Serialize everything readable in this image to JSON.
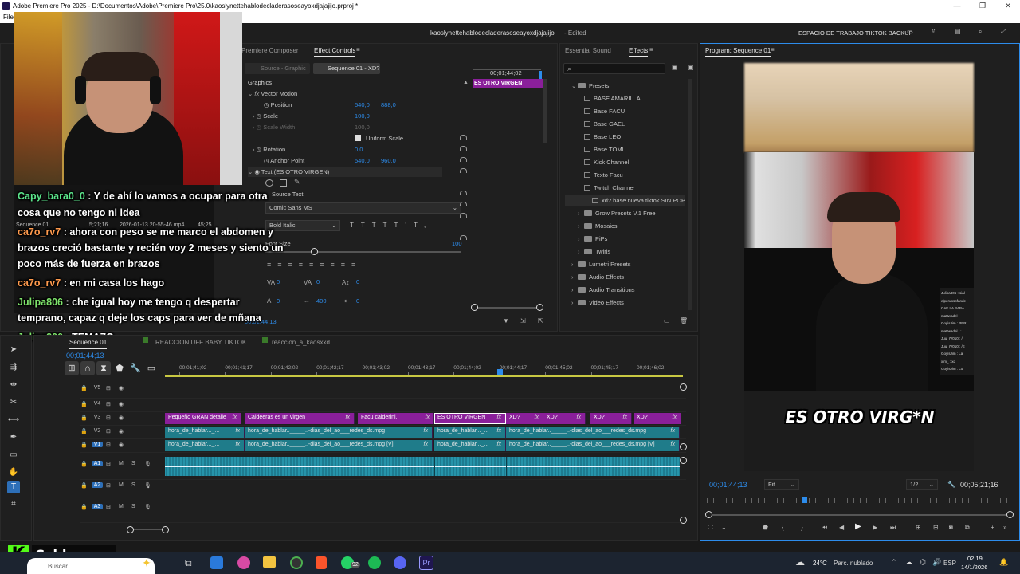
{
  "window": {
    "title": "Adobe Premiere Pro 2025 - D:\\Documentos\\Adobe\\Premiere Pro\\25.0\\kaoslynettehablodecladerasoseayoxdjajajijo.prproj *",
    "project_name": "kaoslynettehablodecladerasoseayoxdjajajijo",
    "edited": "- Edited",
    "workspace": "ESPACIO DE TRABAJO TIKTOK BACKUP",
    "menu_file": "File"
  },
  "source_panel": {
    "tabs": [
      "Premiere Composer",
      "Effect Controls"
    ],
    "subtabs": [
      "Source - Graphic",
      "Sequence 01 - XD?"
    ],
    "timecode": "00;01;44;02",
    "clip_label": "ES OTRO VIRGEN",
    "graphics_label": "Graphics",
    "vector_motion": "Vector Motion",
    "properties": [
      {
        "name": "Position",
        "v1": "540,0",
        "v2": "888,0"
      },
      {
        "name": "Scale",
        "v1": "100,0",
        "v2": ""
      },
      {
        "name": "Scale Width",
        "v1": "100,0",
        "v2": ""
      },
      {
        "name": "Rotation",
        "v1": "0,0",
        "v2": ""
      },
      {
        "name": "Anchor Point",
        "v1": "540,0",
        "v2": "960,0"
      }
    ],
    "uniform_scale": "Uniform Scale",
    "text_layer": "Text (ES OTRO VIRGEN)",
    "source_text": "Source Text",
    "font": "Comic Sans MS",
    "font_style": "Bold Italic",
    "font_size_label": "Font Size",
    "font_size": "100",
    "tracking_values": [
      "0",
      "0",
      "0",
      "0",
      "400",
      "0"
    ],
    "bottom_timecode": "00;01;44;13"
  },
  "webcam": {
    "seq_label": "Sequence 01",
    "seq_time": "5;21;16",
    "file_label": "2026-01-13 20-55-46.mp4",
    "file_time": "45;25"
  },
  "chat": [
    {
      "user": "Capy_bara0_0",
      "text": ": Y de ahí lo vamos a ocupar para otra",
      "text2": "cosa que no tengo ni idea"
    },
    {
      "user": "ca7o_rv7",
      "text": ": ahora con peso se me marco el abdomen y",
      "text2": "brazos creció bastante y recién voy 2 meses y siento un",
      "text3": "poco más de fuerza en brazos"
    },
    {
      "user": "ca7o_rv7",
      "text": ": en mi casa los hago"
    },
    {
      "user": "Julipa806",
      "text": ": che igual hoy me tengo q despertar",
      "text2": "temprano, capaz q deje los caps para ver de mñana"
    },
    {
      "user": "Julipa806",
      "text": ": TEMAZO"
    }
  ],
  "effects_panel": {
    "tabs": [
      "Essential Sound",
      "Effects"
    ],
    "search_placeholder": "",
    "tree": [
      {
        "level": 0,
        "type": "folder",
        "open": true,
        "label": "Presets"
      },
      {
        "level": 1,
        "type": "preset",
        "label": "BASE AMARILLA"
      },
      {
        "level": 1,
        "type": "preset",
        "label": "Base FACU"
      },
      {
        "level": 1,
        "type": "preset",
        "label": "Base GAEL"
      },
      {
        "level": 1,
        "type": "preset",
        "label": "Base LEO"
      },
      {
        "level": 1,
        "type": "preset",
        "label": "Base TOMI"
      },
      {
        "level": 1,
        "type": "preset",
        "label": "Kick Channel"
      },
      {
        "level": 1,
        "type": "preset",
        "label": "Texto Facu"
      },
      {
        "level": 1,
        "type": "preset",
        "label": "Twitch Channel"
      },
      {
        "level": 1,
        "type": "preset",
        "label": "xd? base nueva tiktok SIN POP",
        "selected": true
      },
      {
        "level": 1,
        "type": "folder",
        "open": false,
        "label": "Grow Presets V.1 Free"
      },
      {
        "level": 1,
        "type": "folder",
        "open": false,
        "label": "Mosaics"
      },
      {
        "level": 1,
        "type": "folder",
        "open": false,
        "label": "PiPs"
      },
      {
        "level": 1,
        "type": "folder",
        "open": false,
        "label": "Twirls"
      },
      {
        "level": 0,
        "type": "folder",
        "open": false,
        "label": "Lumetri Presets"
      },
      {
        "level": 0,
        "type": "folder",
        "open": false,
        "label": "Audio Effects"
      },
      {
        "level": 0,
        "type": "folder",
        "open": false,
        "label": "Audio Transitions"
      },
      {
        "level": 0,
        "type": "folder",
        "open": false,
        "label": "Video Effects"
      }
    ]
  },
  "program": {
    "tab": "Program: Sequence 01",
    "caption": "ES OTRO VIRG*N",
    "timecode": "00;01;44;13",
    "fit": "Fit",
    "resolution": "1/2",
    "duration": "00;05;21;16",
    "stream_chat": [
      "Julipa806 : sial",
      "elperuosofande",
      "CAE LA BABA",
      "mattwadel :",
      "GoyisJim : PER",
      "mattwadel : :",
      "Juu_rV010 : /",
      "Juu_rV010 : /E",
      "GoyisJim : La",
      "xlm_ : xd",
      "GoyisJim : Lo"
    ]
  },
  "timeline": {
    "tabs": [
      "Sequence 01",
      "REACCION UFF BABY TIKTOK",
      "reaccion_a_kaosxxd"
    ],
    "timecode": "00;01;44;13",
    "ruler": [
      "00;01;41;02",
      "00;01;41;17",
      "00;01;42;02",
      "00;01;42;17",
      "00;01;43;02",
      "00;01;43;17",
      "00;01;44;02",
      "00;01;44;17",
      "00;01;45;02",
      "00;01;45;17",
      "00;01;46;02"
    ],
    "video_tracks": [
      "V5",
      "V4",
      "V3",
      "V2",
      "V1"
    ],
    "audio_tracks": [
      "A1",
      "A2",
      "A3"
    ],
    "audio_buttons": [
      "M",
      "S"
    ],
    "v3_clips": [
      "Pequeño GRAN detalle",
      "Caldeeras es un virgen",
      "Facu calderini..",
      "ES OTRO VIRGEN",
      "XD?",
      "XD?",
      "XD?",
      "XD?"
    ],
    "v2_clips": [
      "hora_de_hablar..._...",
      "hora_de_hablar.._____..-dias_del_ao___redes_ds.mpg",
      "hora_de_hablar..._...",
      "hora_de_hablar.._____..-dias_del_ao___redes_ds.mpg"
    ],
    "v1_clips": [
      "hora_de_hablar..._...",
      "hora_de_hablar.._____..-dias_del_ao___redes_ds.mpg [V]",
      "hora_de_hablar..._...",
      "hora_de_hablar.._____..-dias_del_ao___redes_ds.mpg [V]"
    ]
  },
  "overlay": {
    "brand_letter": "K",
    "streamer": "Caldeerass"
  },
  "taskbar": {
    "search": "Buscar",
    "weather": "24°C",
    "weather_desc": "Parc. nublado",
    "lang": "ESP",
    "time": "02:19",
    "date": "14/1/2026",
    "badge": "92"
  },
  "colors": {
    "accent_blue": "#2d8ceb",
    "clip_purple": "#8a1f9a",
    "clip_teal": "#1f7c8a",
    "chat_green": "#5be38a",
    "chat_orange": "#ff9a4d",
    "kick_green": "#53fc18"
  }
}
